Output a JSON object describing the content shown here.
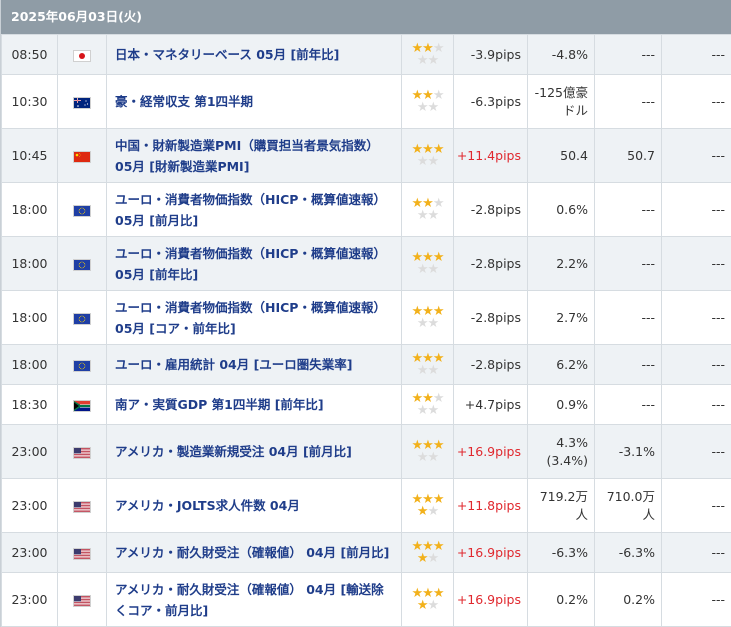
{
  "header": {
    "date": "2025年06月03日(火)"
  },
  "colors": {
    "event_text": "#1f3d8a",
    "pips_up": "#e0282e",
    "star_on": "#f2b11b",
    "star_off": "#dcdcdc",
    "header_bg": "#8f9ca6"
  },
  "rows": [
    {
      "time": "08:50",
      "flag": "jp-flag-icon",
      "event": "日本・マネタリーベース 05月 [前年比]",
      "stars": 2,
      "stars_max": 3,
      "extra_star": false,
      "pips": "-3.9pips",
      "up": false,
      "result": "-4.8%",
      "forecast": "---",
      "previous": "---"
    },
    {
      "time": "10:30",
      "flag": "au-flag-icon",
      "event": "豪・経常収支 第1四半期",
      "stars": 2,
      "stars_max": 3,
      "extra_star": false,
      "pips": "-6.3pips",
      "up": false,
      "result": "-125億豪ドル",
      "forecast": "---",
      "previous": "---"
    },
    {
      "time": "10:45",
      "flag": "cn-flag-icon",
      "event": "中国・財新製造業PMI（購買担当者景気指数） 05月 [財新製造業PMI]",
      "stars": 3,
      "stars_max": 3,
      "extra_star": false,
      "pips": "+11.4pips",
      "up": true,
      "result": "50.4",
      "forecast": "50.7",
      "previous": "---"
    },
    {
      "time": "18:00",
      "flag": "eu-flag-icon",
      "event": "ユーロ・消費者物価指数（HICP・概算値速報） 05月 [前月比]",
      "stars": 2,
      "stars_max": 3,
      "extra_star": false,
      "pips": "-2.8pips",
      "up": false,
      "result": "0.6%",
      "forecast": "---",
      "previous": "---"
    },
    {
      "time": "18:00",
      "flag": "eu-flag-icon",
      "event": "ユーロ・消費者物価指数（HICP・概算値速報） 05月 [前年比]",
      "stars": 3,
      "stars_max": 3,
      "extra_star": false,
      "pips": "-2.8pips",
      "up": false,
      "result": "2.2%",
      "forecast": "---",
      "previous": "---"
    },
    {
      "time": "18:00",
      "flag": "eu-flag-icon",
      "event": "ユーロ・消費者物価指数（HICP・概算値速報） 05月 [コア・前年比]",
      "stars": 3,
      "stars_max": 3,
      "extra_star": false,
      "pips": "-2.8pips",
      "up": false,
      "result": "2.7%",
      "forecast": "---",
      "previous": "---"
    },
    {
      "time": "18:00",
      "flag": "eu-flag-icon",
      "event": "ユーロ・雇用統計 04月 [ユーロ圏失業率]",
      "stars": 3,
      "stars_max": 3,
      "extra_star": false,
      "pips": "-2.8pips",
      "up": false,
      "result": "6.2%",
      "forecast": "---",
      "previous": "---"
    },
    {
      "time": "18:30",
      "flag": "za-flag-icon",
      "event": "南ア・実質GDP 第1四半期 [前年比]",
      "stars": 2,
      "stars_max": 3,
      "extra_star": false,
      "pips": "+4.7pips",
      "up": false,
      "result": "0.9%",
      "forecast": "---",
      "previous": "---"
    },
    {
      "time": "23:00",
      "flag": "us-flag-icon",
      "event": "アメリカ・製造業新規受注 04月 [前月比]",
      "stars": 3,
      "stars_max": 3,
      "extra_star": false,
      "pips": "+16.9pips",
      "up": true,
      "result": "4.3%\n(3.4%)",
      "forecast": "-3.1%",
      "previous": "---"
    },
    {
      "time": "23:00",
      "flag": "us-flag-icon",
      "event": "アメリカ・JOLTS求人件数 04月",
      "stars": 3,
      "stars_max": 3,
      "extra_star": true,
      "pips": "+11.8pips",
      "up": true,
      "result": "719.2万人",
      "forecast": "710.0万人",
      "previous": "---"
    },
    {
      "time": "23:00",
      "flag": "us-flag-icon",
      "event": "アメリカ・耐久財受注（確報値） 04月 [前月比]",
      "stars": 3,
      "stars_max": 3,
      "extra_star": true,
      "pips": "+16.9pips",
      "up": true,
      "result": "-6.3%",
      "forecast": "-6.3%",
      "previous": "---"
    },
    {
      "time": "23:00",
      "flag": "us-flag-icon",
      "event": "アメリカ・耐久財受注（確報値） 04月 [輸送除くコア・前月比]",
      "stars": 3,
      "stars_max": 3,
      "extra_star": true,
      "pips": "+16.9pips",
      "up": true,
      "result": "0.2%",
      "forecast": "0.2%",
      "previous": "---"
    }
  ]
}
